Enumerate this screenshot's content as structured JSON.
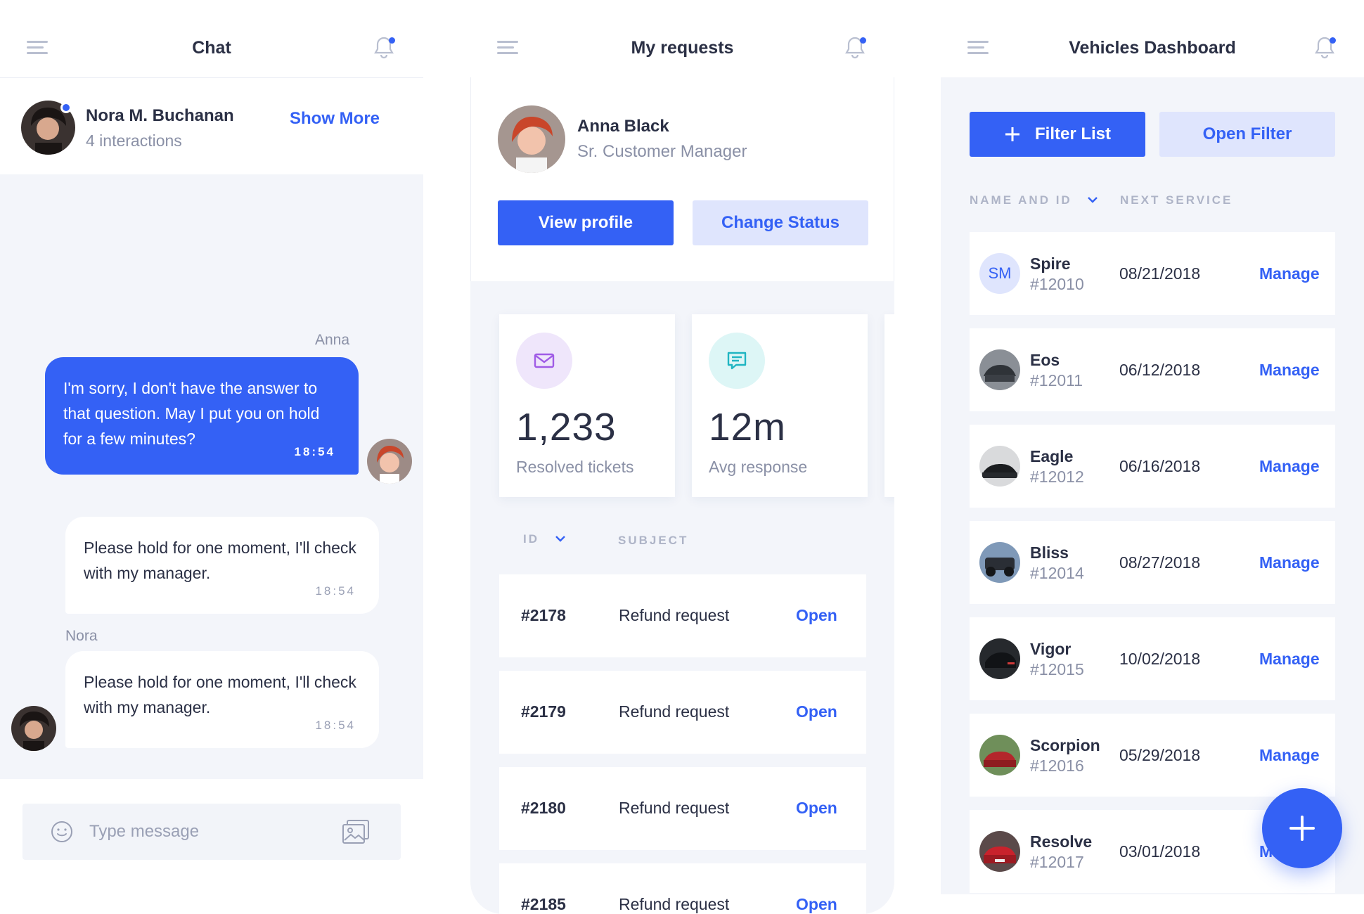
{
  "chat": {
    "title": "Chat",
    "contact": {
      "name": "Nora M. Buchanan",
      "interactions": "4 interactions",
      "show_more": "Show More"
    },
    "messages": [
      {
        "sender": "Anna",
        "text": "I'm sorry, I don't have the answer to that question. May I put you on hold for a few minutes?",
        "time": "18:54"
      },
      {
        "sender": "",
        "text": "Please hold for one moment, I'll check with my manager.",
        "time": "18:54"
      },
      {
        "sender": "Nora",
        "text": "Please hold for one moment, I'll check with my manager.",
        "time": "18:54"
      }
    ],
    "composer": {
      "placeholder": "Type message"
    }
  },
  "requests": {
    "title": "My requests",
    "profile": {
      "name": "Anna Black",
      "role": "Sr. Customer Manager",
      "view_profile": "View profile",
      "change_status": "Change Status"
    },
    "stats": [
      {
        "value": "1,233",
        "label": "Resolved tickets",
        "icon": "mail-icon"
      },
      {
        "value": "12m",
        "label": "Avg response",
        "icon": "message-icon"
      }
    ],
    "columns": {
      "id": "ID",
      "subject": "SUBJECT"
    },
    "rows": [
      {
        "id": "#2178",
        "subject": "Refund request",
        "action": "Open"
      },
      {
        "id": "#2179",
        "subject": "Refund request",
        "action": "Open"
      },
      {
        "id": "#2180",
        "subject": "Refund request",
        "action": "Open"
      },
      {
        "id": "#2185",
        "subject": "Refund request",
        "action": "Open"
      }
    ]
  },
  "vehicles": {
    "title": "Vehicles Dashboard",
    "filter_list": "Filter List",
    "open_filter": "Open Filter",
    "columns": {
      "name": "NAME AND ID",
      "service": "NEXT SERVICE"
    },
    "rows": [
      {
        "name": "Spire",
        "id": "#12010",
        "date": "08/21/2018",
        "action": "Manage",
        "initials": "SM"
      },
      {
        "name": "Eos",
        "id": "#12011",
        "date": "06/12/2018",
        "action": "Manage"
      },
      {
        "name": "Eagle",
        "id": "#12012",
        "date": "06/16/2018",
        "action": "Manage"
      },
      {
        "name": "Bliss",
        "id": "#12014",
        "date": "08/27/2018",
        "action": "Manage"
      },
      {
        "name": "Vigor",
        "id": "#12015",
        "date": "10/02/2018",
        "action": "Manage"
      },
      {
        "name": "Scorpion",
        "id": "#12016",
        "date": "05/29/2018",
        "action": "Manage"
      },
      {
        "name": "Resolve",
        "id": "#12017",
        "date": "03/01/2018",
        "action": "Manage"
      }
    ]
  },
  "colors": {
    "accent": "#3461f5",
    "accent_light": "#dfe5fd",
    "background": "#f3f5fa",
    "text": "#2b3045",
    "muted": "#8a90a6"
  }
}
